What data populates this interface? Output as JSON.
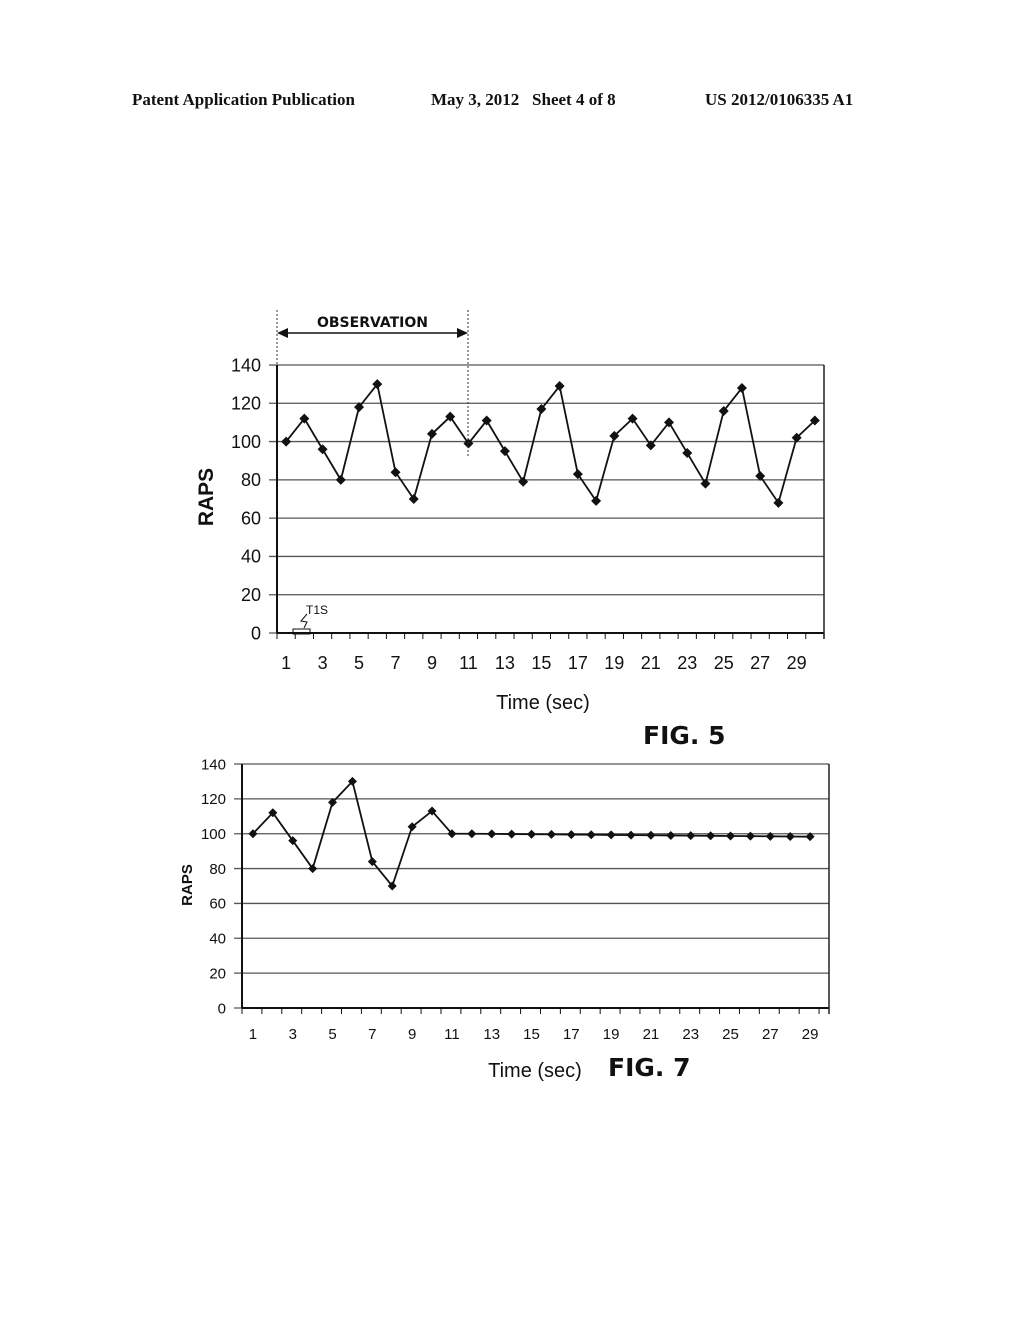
{
  "header": {
    "left": "Patent Application Publication",
    "middle": "May 3, 2012   Sheet 4 of 8",
    "right": "US 2012/0106335 A1"
  },
  "chart_data": [
    {
      "type": "line",
      "figure_label": "FIG. 5",
      "title": "",
      "xlabel": "Time (sec)",
      "ylabel": "RAPS",
      "ylim": [
        0,
        140
      ],
      "yticks": [
        0,
        20,
        40,
        60,
        80,
        100,
        120,
        140
      ],
      "x": [
        1,
        2,
        3,
        4,
        5,
        6,
        7,
        8,
        9,
        10,
        11,
        12,
        13,
        14,
        15,
        16,
        17,
        18,
        19,
        20,
        21,
        22,
        23,
        24,
        25,
        26,
        27,
        28,
        29,
        30
      ],
      "xtick_labels": [
        "1",
        "3",
        "5",
        "7",
        "9",
        "11",
        "13",
        "15",
        "17",
        "19",
        "21",
        "23",
        "25",
        "27",
        "29"
      ],
      "grid": true,
      "marker": "diamond",
      "series": [
        {
          "name": "RAPS",
          "values": [
            100,
            112,
            96,
            80,
            118,
            130,
            84,
            70,
            104,
            113,
            99,
            111,
            95,
            79,
            117,
            129,
            83,
            69,
            103,
            112,
            98,
            110,
            94,
            78,
            116,
            128,
            82,
            68,
            102,
            111
          ]
        }
      ],
      "annotations": [
        {
          "text": "OBSERVATION",
          "type": "span-arrow",
          "x_range": [
            1,
            11
          ]
        },
        {
          "text": "T1S",
          "type": "callout",
          "x_range": [
            2,
            3
          ],
          "y": 0
        }
      ]
    },
    {
      "type": "line",
      "figure_label": "FIG. 7",
      "title": "",
      "xlabel": "Time (sec)",
      "ylabel": "RAPS",
      "ylim": [
        0,
        140
      ],
      "yticks": [
        0,
        20,
        40,
        60,
        80,
        100,
        120,
        140
      ],
      "x": [
        1,
        2,
        3,
        4,
        5,
        6,
        7,
        8,
        9,
        10,
        11,
        12,
        13,
        14,
        15,
        16,
        17,
        18,
        19,
        20,
        21,
        22,
        23,
        24,
        25,
        26,
        27,
        28,
        29
      ],
      "xtick_labels": [
        "1",
        "3",
        "5",
        "7",
        "9",
        "11",
        "13",
        "15",
        "17",
        "19",
        "21",
        "23",
        "25",
        "27",
        "29"
      ],
      "grid": true,
      "marker": "diamond",
      "series": [
        {
          "name": "RAPS",
          "values": [
            100,
            112,
            96,
            80,
            118,
            130,
            84,
            70,
            104,
            113,
            100,
            100,
            99.9,
            99.8,
            99.7,
            99.6,
            99.5,
            99.4,
            99.3,
            99.2,
            99.1,
            99,
            98.9,
            98.8,
            98.7,
            98.6,
            98.5,
            98.4,
            98.3
          ]
        }
      ]
    }
  ]
}
